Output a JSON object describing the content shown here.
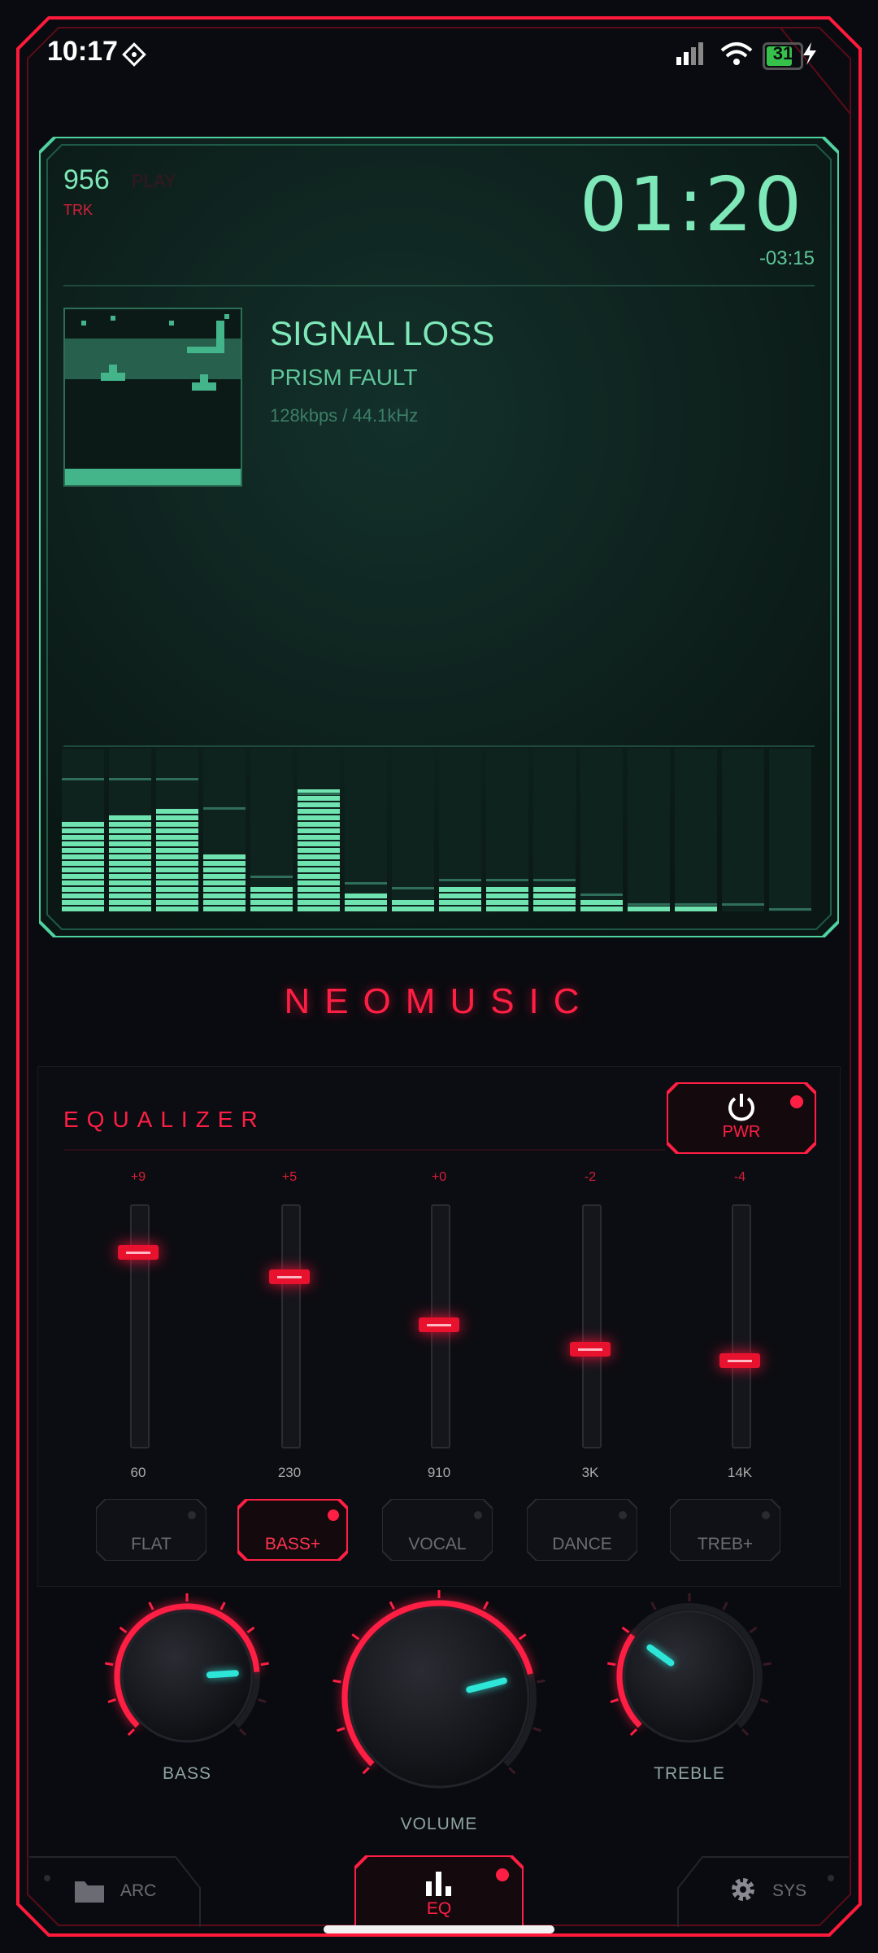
{
  "status": {
    "time": "10:17",
    "battery": "31"
  },
  "player": {
    "track_number": "956",
    "track_label": "TRK",
    "play_state": "PLAY",
    "elapsed": "01:20",
    "remaining": "-03:15",
    "title": "SIGNAL LOSS",
    "artist": "PRISM FAULT",
    "quality": "128kbps / 44.1kHz",
    "spectrum_levels": [
      0.56,
      0.6,
      0.64,
      0.37,
      0.16,
      0.77,
      0.11,
      0.07,
      0.16,
      0.16,
      0.16,
      0.07,
      0.03,
      0.03,
      0,
      0
    ],
    "spectrum_peaks": [
      0.82,
      0.82,
      0.82,
      0.64,
      0.22,
      0.73,
      0.18,
      0.15,
      0.2,
      0.2,
      0.2,
      0.11,
      0.05,
      0.05,
      0.05,
      0.02
    ]
  },
  "brand": "NEOMUSIC",
  "equalizer": {
    "title": "EQUALIZER",
    "power_label": "PWR",
    "bands": [
      {
        "freq": "60",
        "gain": "+9",
        "level": 0.8
      },
      {
        "freq": "230",
        "gain": "+5",
        "level": 0.7
      },
      {
        "freq": "910",
        "gain": "+0",
        "level": 0.5
      },
      {
        "freq": "3K",
        "gain": "-2",
        "level": 0.4
      },
      {
        "freq": "14K",
        "gain": "-4",
        "level": 0.35
      }
    ],
    "presets": [
      {
        "label": "FLAT",
        "active": false
      },
      {
        "label": "BASS+",
        "active": true
      },
      {
        "label": "VOCAL",
        "active": false
      },
      {
        "label": "DANCE",
        "active": false
      },
      {
        "label": "TREB+",
        "active": false
      }
    ]
  },
  "knobs": {
    "bass": {
      "label": "BASS",
      "level": 0.82
    },
    "volume": {
      "label": "VOLUME",
      "level": 0.78
    },
    "treble": {
      "label": "TREBLE",
      "level": 0.3
    }
  },
  "nav": {
    "archive": "ARC",
    "eq": "EQ",
    "system": "SYS"
  },
  "colors": {
    "accent": "#ff1f44",
    "display": "#7ee8b8",
    "needle": "#2ee6d8"
  }
}
